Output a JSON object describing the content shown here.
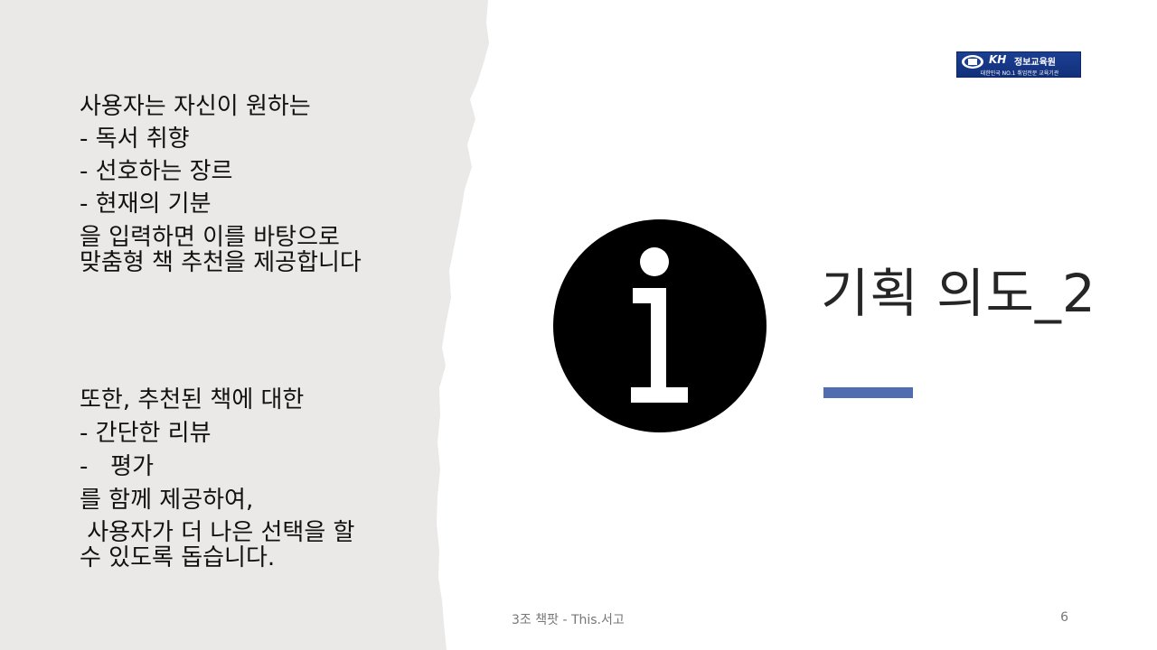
{
  "slide": {
    "title": "기획 의도_2",
    "colors": {
      "left_panel": "#ebe9e7",
      "accent_bar": "#4f6db0",
      "icon": "#000000",
      "logo_background": "#1c3f93"
    },
    "icon": "info-icon",
    "left_text": {
      "block1": [
        "사용자는 자신이 원하는",
        "- 독서 취향",
        "- 선호하는 장르",
        "- 현재의 기분",
        "을 입력하면 이를 바탕으로",
        "맞춤형 책 추천을 제공합니다"
      ],
      "block2": [
        "또한, 추천된 책에 대한",
        "- 간단한 리뷰",
        "-   평가",
        "를 함께 제공하여,",
        " 사용자가 더 나은 선택을 할",
        "수 있도록 돕습니다."
      ]
    },
    "logo": {
      "brand": "KH",
      "name": "정보교육원",
      "tagline": "대한민국 NO.1 취업전문 교육기관"
    },
    "footer": {
      "text": "3조 책팟 - This.서고",
      "page_number": "6"
    }
  }
}
